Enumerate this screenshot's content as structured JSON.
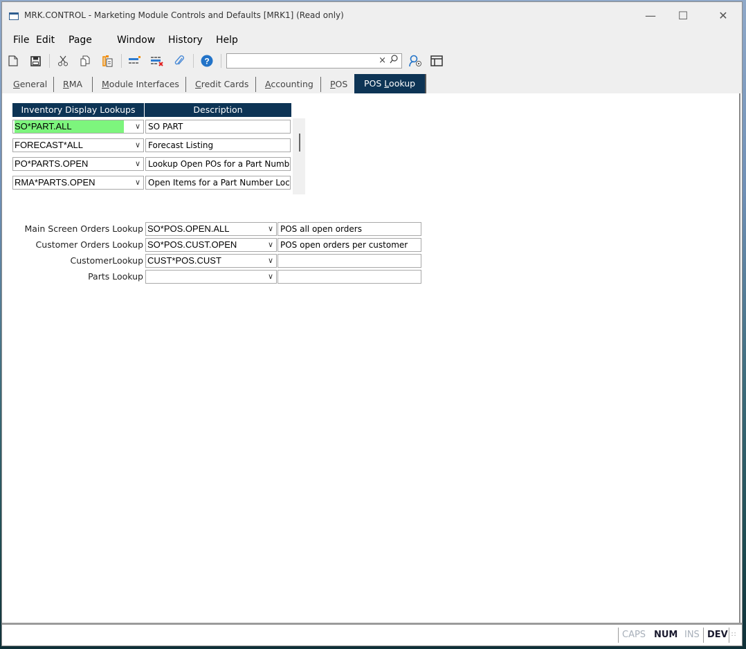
{
  "window": {
    "title": "MRK.CONTROL - Marketing Module Controls and Defaults [MRK1] (Read only)",
    "controls": {
      "minimize": "—",
      "maximize": "☐",
      "close": "✕"
    }
  },
  "menu": [
    "File",
    "Edit",
    "Page",
    "Window",
    "History",
    "Help"
  ],
  "toolbar": {
    "icons": [
      "new-document-icon",
      "save-icon",
      "cut-icon",
      "copy-icon",
      "paste-icon",
      "insert-row-icon",
      "delete-row-icon",
      "attachment-icon",
      "help-icon"
    ],
    "search": {
      "value": "",
      "placeholder": "",
      "clear": "×",
      "go": "⌕"
    },
    "extra_icons": [
      "lookup-icon",
      "layout-icon"
    ]
  },
  "tabs": [
    {
      "label": "General",
      "accel": "G",
      "rest": "eneral",
      "active": false
    },
    {
      "label": "RMA",
      "accel": "R",
      "rest": "MA",
      "active": false
    },
    {
      "label": "Module Interfaces",
      "accel": "M",
      "rest": "odule Interfaces",
      "active": false
    },
    {
      "label": "Credit Cards",
      "accel": "C",
      "rest": "redit Cards",
      "active": false
    },
    {
      "label": "Accounting",
      "accel": "A",
      "rest": "ccounting",
      "active": false
    },
    {
      "label": "POS",
      "accel": "P",
      "rest": "OS",
      "active": false
    },
    {
      "label": "POS Lookup",
      "pre": "POS ",
      "accel": "L",
      "rest": "ookup",
      "active": true
    }
  ],
  "inventory_grid": {
    "headers": [
      "Inventory Display Lookups",
      "Description"
    ],
    "rows": [
      {
        "lookup": "SO*PART.ALL",
        "description": "SO PART",
        "highlight": true
      },
      {
        "lookup": "FORECAST*ALL",
        "description": "Forecast Listing"
      },
      {
        "lookup": "PO*PARTS.OPEN",
        "description": "Lookup Open POs for a Part Numb"
      },
      {
        "lookup": "RMA*PARTS.OPEN",
        "description": "Open Items for a Part Number Loc"
      }
    ]
  },
  "pos_lookups": [
    {
      "label": "Main Screen Orders Lookup",
      "value": "SO*POS.OPEN.ALL",
      "description": "POS all open orders"
    },
    {
      "label": "Customer Orders Lookup",
      "value": "SO*POS.CUST.OPEN",
      "description": "POS open orders per customer"
    },
    {
      "label": "CustomerLookup",
      "value": "CUST*POS.CUST",
      "description": ""
    },
    {
      "label": "Parts Lookup",
      "value": "",
      "description": ""
    }
  ],
  "status": {
    "caps": "CAPS",
    "num": "NUM",
    "ins": "INS",
    "dev": "DEV"
  },
  "colors": {
    "accent": "#0d3455",
    "highlight": "#7df57d"
  }
}
